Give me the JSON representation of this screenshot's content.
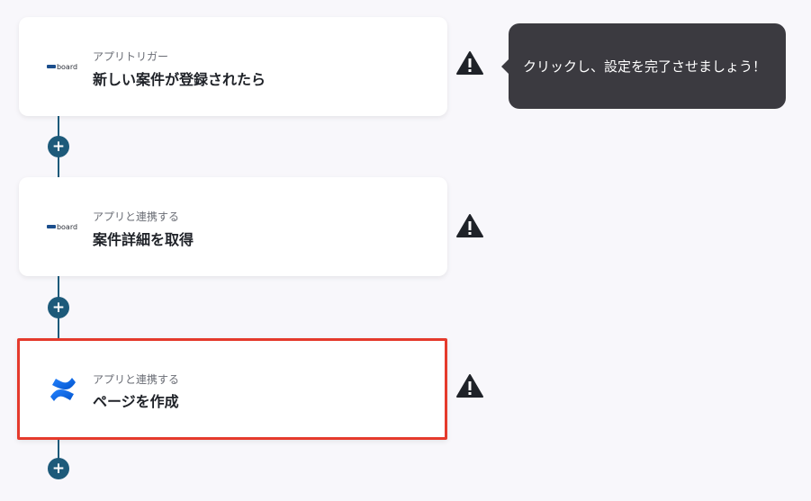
{
  "steps": [
    {
      "subtitle": "アプリトリガー",
      "title": "新しい案件が登録されたら",
      "app_icon": "board-logo",
      "logo_text": "board"
    },
    {
      "subtitle": "アプリと連携する",
      "title": "案件詳細を取得",
      "app_icon": "board-logo",
      "logo_text": "board"
    },
    {
      "subtitle": "アプリと連携する",
      "title": "ページを作成",
      "app_icon": "confluence-logo"
    }
  ],
  "tooltip": {
    "text": "クリックし、設定を完了させましょう！"
  },
  "add_button": {
    "label": "+"
  },
  "colors": {
    "connector": "#1d5a7a",
    "selected_border": "#e53a2c",
    "tooltip_bg": "#3b3a40"
  }
}
